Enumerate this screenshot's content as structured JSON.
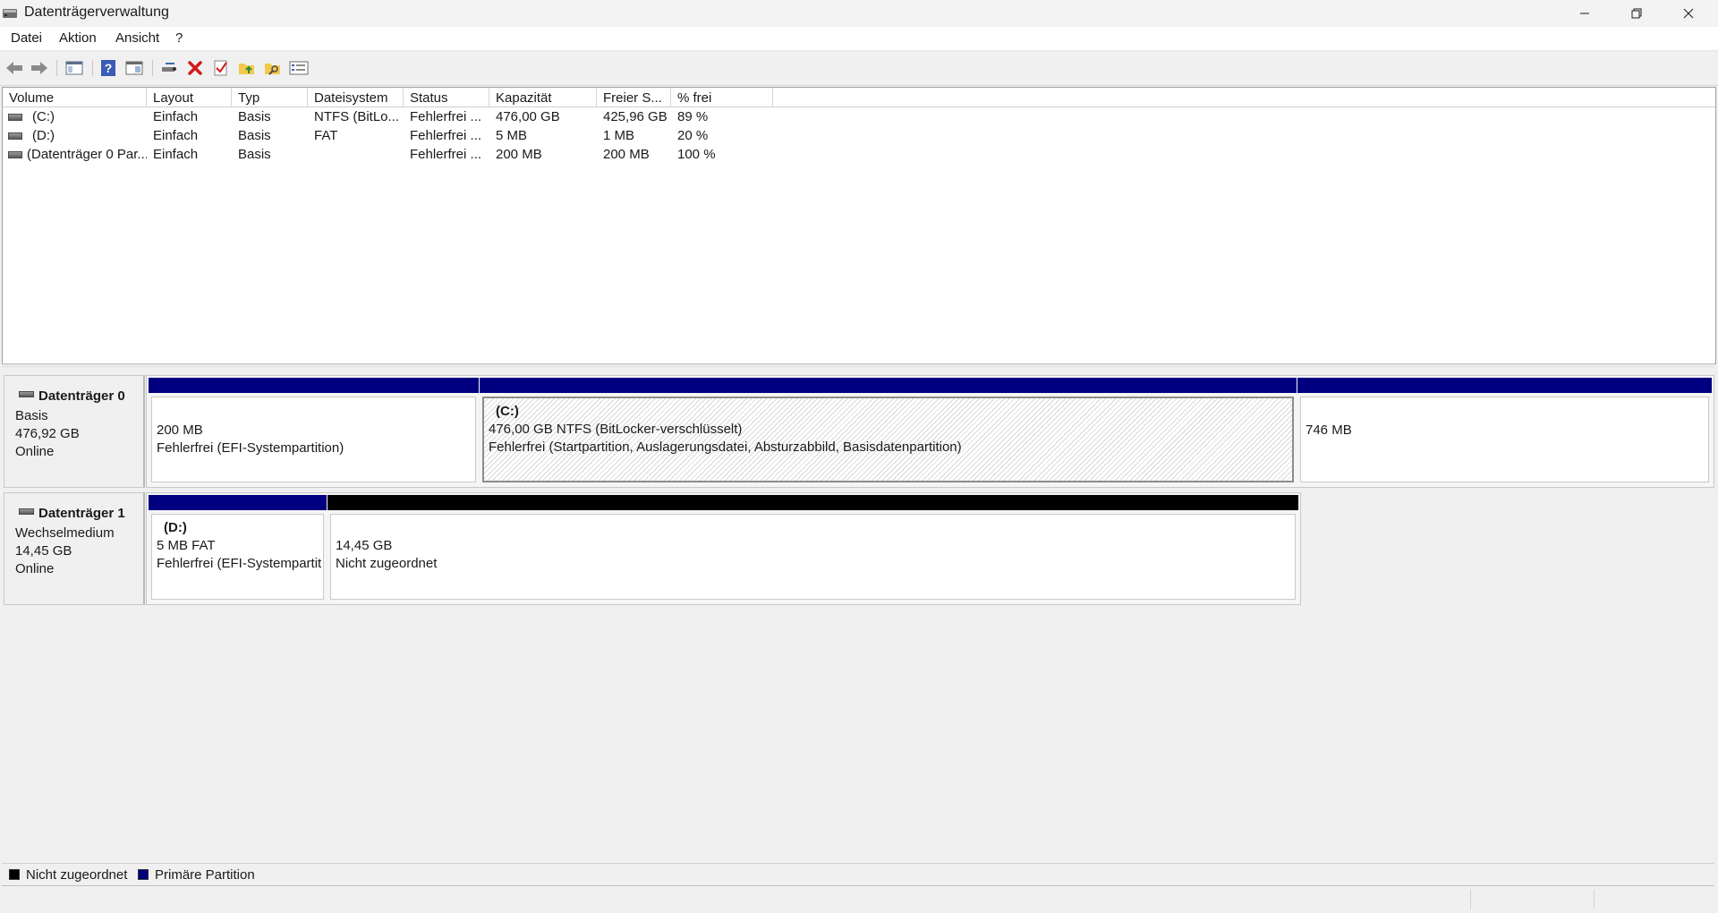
{
  "window": {
    "title": "Datenträgerverwaltung"
  },
  "menu": [
    "Datei",
    "Aktion",
    "Ansicht",
    "?"
  ],
  "toolbar": {
    "icons": [
      "back-arrow-icon",
      "forward-arrow-icon",
      "console-tree-icon",
      "help-icon",
      "properties-view-icon",
      "connect-disk-icon",
      "delete-icon",
      "check-icon",
      "folder-up-icon",
      "folder-search-icon",
      "list-view-icon"
    ]
  },
  "volume_list": {
    "columns": [
      "Volume",
      "Layout",
      "Typ",
      "Dateisystem",
      "Status",
      "Kapazität",
      "Freier S...",
      "% frei"
    ],
    "rows": [
      {
        "volume": "(C:)",
        "layout": "Einfach",
        "typ": "Basis",
        "fs": "NTFS (BitLo...",
        "status": "Fehlerfrei ...",
        "kap": "476,00 GB",
        "frei": "425,96 GB",
        "pct": "89 %"
      },
      {
        "volume": "(D:)",
        "layout": "Einfach",
        "typ": "Basis",
        "fs": "FAT",
        "status": "Fehlerfrei ...",
        "kap": "5 MB",
        "frei": "1 MB",
        "pct": "20 %"
      },
      {
        "volume": "(Datenträger 0 Par...",
        "layout": "Einfach",
        "typ": "Basis",
        "fs": "",
        "status": "Fehlerfrei ...",
        "kap": "200 MB",
        "frei": "200 MB",
        "pct": "100 %"
      }
    ]
  },
  "disks": [
    {
      "name": "Datenträger 0",
      "type": "Basis",
      "size": "476,92 GB",
      "state": "Online",
      "partitions": [
        {
          "title": "",
          "line1": "200 MB",
          "line2": "Fehlerfrei (EFI-Systempartition)"
        },
        {
          "title": "(C:)",
          "line1": "476,00 GB NTFS (BitLocker-verschlüsselt)",
          "line2": "Fehlerfrei (Startpartition, Auslagerungsdatei, Absturzabbild, Basisdatenpartition)"
        },
        {
          "title": "",
          "line1": "746 MB",
          "line2": ""
        }
      ]
    },
    {
      "name": "Datenträger 1",
      "type": "Wechselmedium",
      "size": "14,45 GB",
      "state": "Online",
      "partitions": [
        {
          "title": "(D:)",
          "line1": "5 MB FAT",
          "line2": "Fehlerfrei (EFI-Systempartit"
        },
        {
          "title": "",
          "line1": "14,45 GB",
          "line2": "Nicht zugeordnet"
        }
      ]
    }
  ],
  "legend": [
    {
      "label": "Nicht zugeordnet",
      "color": "#000000"
    },
    {
      "label": "Primäre Partition",
      "color": "#000080"
    }
  ],
  "colors": {
    "primary": "#000080",
    "unallocated": "#000000"
  }
}
